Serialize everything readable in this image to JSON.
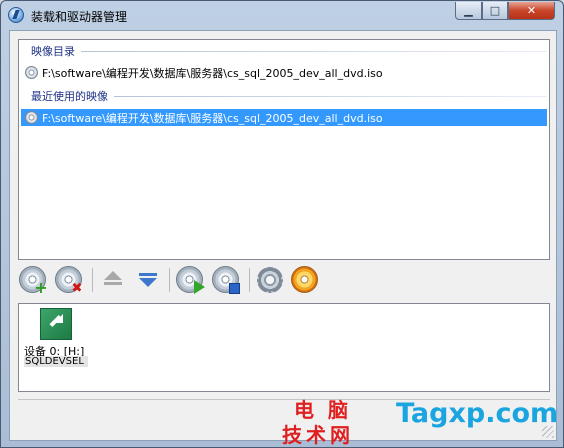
{
  "window": {
    "title": "装载和驱动器管理",
    "controls": {
      "minimize": "▁",
      "maximize": "□",
      "close": "✕"
    }
  },
  "image_list": {
    "groups": [
      {
        "label": "映像目录",
        "items": [
          {
            "path": "F:\\software\\编程开发\\数据库\\服务器\\cs_sql_2005_dev_all_dvd.iso",
            "selected": false
          }
        ]
      },
      {
        "label": "最近使用的映像",
        "items": [
          {
            "path": "F:\\software\\编程开发\\数据库\\服务器\\cs_sql_2005_dev_all_dvd.iso",
            "selected": true
          }
        ]
      }
    ]
  },
  "toolbar": {
    "buttons": [
      {
        "icon": "disc-add-icon"
      },
      {
        "icon": "disc-remove-icon"
      },
      {
        "icon": "eject-icon"
      },
      {
        "icon": "insert-icon"
      },
      {
        "icon": "disc-play-icon"
      },
      {
        "icon": "disc-stop-icon"
      },
      {
        "icon": "gear-icon"
      },
      {
        "icon": "disc-burn-icon"
      }
    ]
  },
  "devices": [
    {
      "label": "设备 0: [H:]",
      "name": "SQLDEVSEL"
    }
  ],
  "watermark": {
    "line1": "电脑",
    "line2": "技术网",
    "domain": "Tagxp.com"
  },
  "colors": {
    "selection": "#3399ff",
    "group_header": "#1e3287",
    "watermark_red": "#e02020",
    "watermark_blue": "#1aa5e0"
  }
}
